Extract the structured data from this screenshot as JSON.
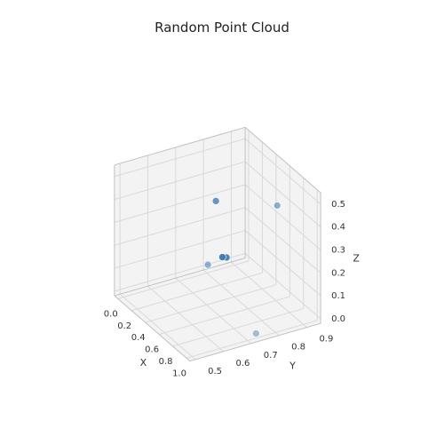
{
  "chart_data": {
    "type": "scatter",
    "title": "Random Point Cloud",
    "xlabel": "X",
    "ylabel": "Y",
    "zlabel": "Z",
    "x_ticks": [
      0.0,
      0.2,
      0.4,
      0.6,
      0.8,
      1.0
    ],
    "y_ticks": [
      0.5,
      0.6,
      0.7,
      0.8,
      0.9
    ],
    "z_ticks": [
      0.0,
      0.1,
      0.2,
      0.3,
      0.4,
      0.5
    ],
    "x_tick_labels": [
      "0.0",
      "0.2",
      "0.4",
      "0.6",
      "0.8",
      "1.0"
    ],
    "y_tick_labels": [
      "0.5",
      "0.6",
      "0.7",
      "0.8",
      "0.9"
    ],
    "z_tick_labels": [
      "0.0",
      "0.1",
      "0.2",
      "0.3",
      "0.4",
      "0.5"
    ],
    "xlim": [
      -0.05,
      1.05
    ],
    "ylim": [
      0.48,
      0.95
    ],
    "zlim": [
      -0.02,
      0.55
    ],
    "points": [
      {
        "x": 0.05,
        "y": 0.82,
        "z": 0.3,
        "alpha": 0.75
      },
      {
        "x": 0.42,
        "y": 0.7,
        "z": 0.16,
        "alpha": 0.55
      },
      {
        "x": 0.55,
        "y": 0.72,
        "z": 0.22,
        "alpha": 0.95
      },
      {
        "x": 0.57,
        "y": 0.73,
        "z": 0.22,
        "alpha": 0.9
      },
      {
        "x": 0.62,
        "y": 0.9,
        "z": 0.4,
        "alpha": 0.55
      },
      {
        "x": 1.0,
        "y": 0.73,
        "z": 0.0,
        "alpha": 0.45
      }
    ],
    "point_color": "#3b77b0",
    "point_radius": 4
  }
}
